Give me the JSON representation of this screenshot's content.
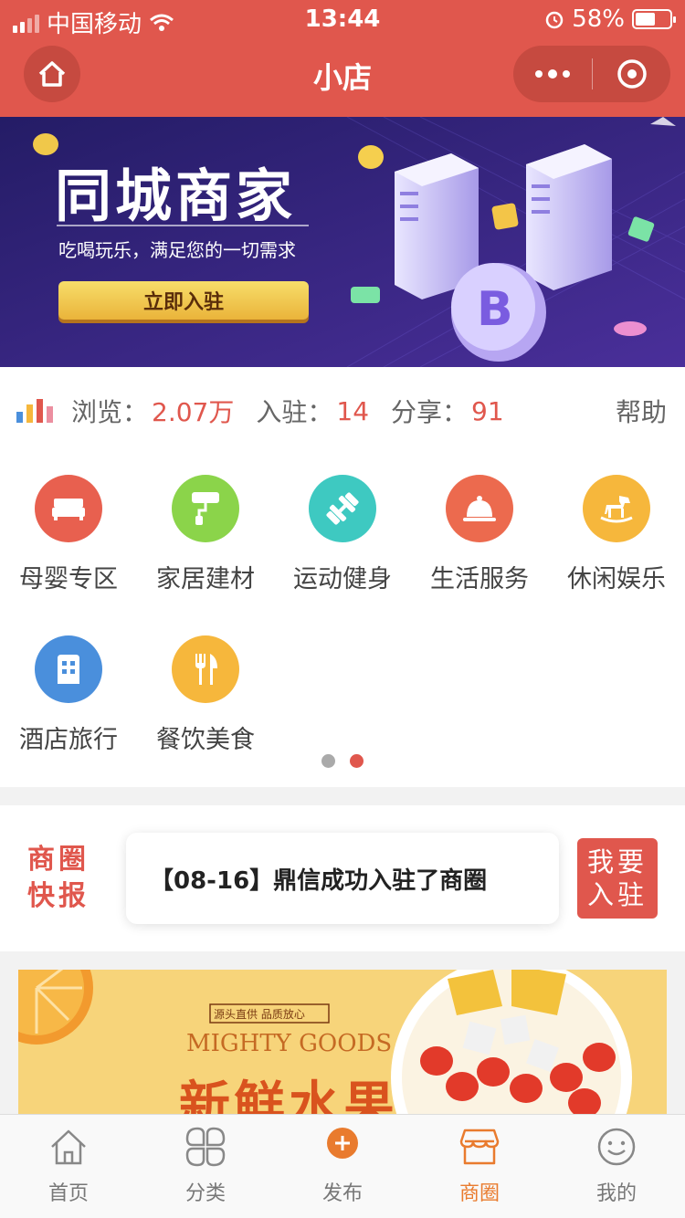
{
  "status_bar": {
    "carrier": "中国移动",
    "time": "13:44",
    "battery": "58%",
    "battery_level": 0.58
  },
  "nav": {
    "title": "小店"
  },
  "banner": {
    "title": "同城商家",
    "subtitle": "吃喝玩乐，满足您的一切需求",
    "button": "立即入驻"
  },
  "stats": {
    "views_label": "浏览：",
    "views_value": "2.07万",
    "joined_label": "入驻：",
    "joined_value": "14",
    "shares_label": "分享：",
    "shares_value": "91",
    "help": "帮助"
  },
  "categories": [
    {
      "label": "母婴专区",
      "icon": "bed-icon",
      "color": "#e8604f"
    },
    {
      "label": "家居建材",
      "icon": "paint-roller-icon",
      "color": "#8bd44a"
    },
    {
      "label": "运动健身",
      "icon": "dumbbell-icon",
      "color": "#3ec9c1"
    },
    {
      "label": "生活服务",
      "icon": "service-bell-icon",
      "color": "#ec6a4e"
    },
    {
      "label": "休闲娱乐",
      "icon": "rocking-horse-icon",
      "color": "#f6b73c"
    },
    {
      "label": "酒店旅行",
      "icon": "hotel-icon",
      "color": "#4a8fdc"
    },
    {
      "label": "餐饮美食",
      "icon": "fork-knife-icon",
      "color": "#f6b73c"
    }
  ],
  "pager": {
    "pages": 2,
    "active": 2
  },
  "news": {
    "tag": "商圈快报",
    "tag_line1": "商圈",
    "tag_line2": "快报",
    "text": "【08-16】鼎信成功入驻了商圈",
    "join_line1": "我要",
    "join_line2": "入驻"
  },
  "ad": {
    "slogan": "源头直供 品质放心",
    "english": "MIGHTY GOODS",
    "title": "新鲜水果"
  },
  "tabs": [
    {
      "label": "首页",
      "icon": "home-icon"
    },
    {
      "label": "分类",
      "icon": "category-icon"
    },
    {
      "label": "发布",
      "icon": "plus-circle-icon"
    },
    {
      "label": "商圈",
      "icon": "shop-icon",
      "active": true
    },
    {
      "label": "我的",
      "icon": "smile-icon"
    }
  ],
  "colors": {
    "primary": "#e0574d",
    "tab_active": "#e97b2e"
  }
}
